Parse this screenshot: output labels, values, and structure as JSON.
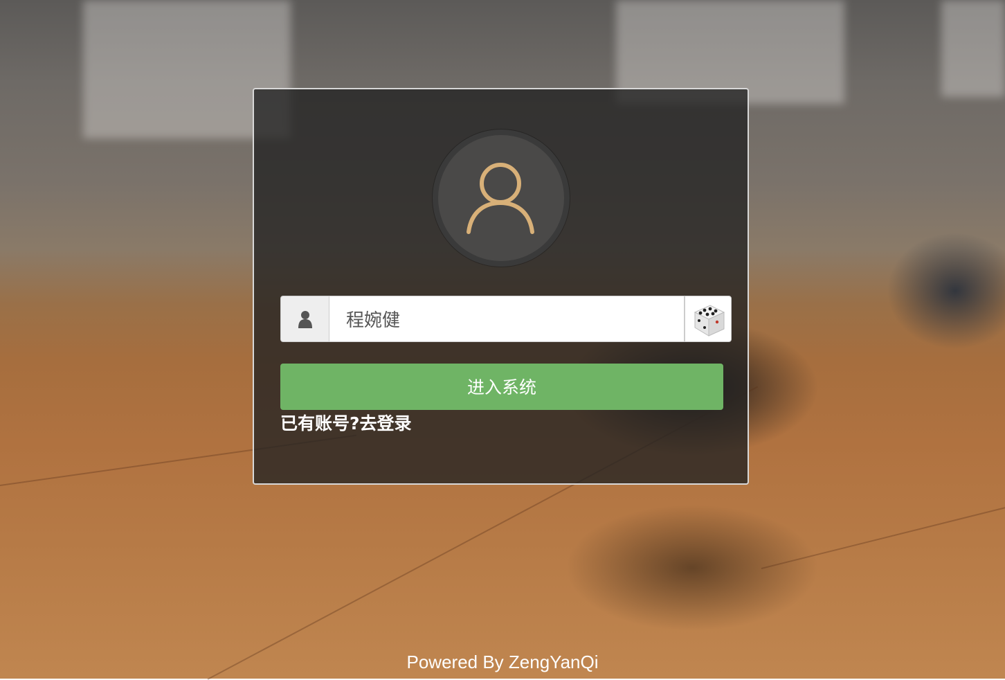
{
  "form": {
    "username_value": "程婉健",
    "submit_label": "进入系统",
    "login_link_label": "已有账号?去登录"
  },
  "footer": {
    "text": "Powered By ZengYanQi"
  },
  "icons": {
    "avatar": "user-outline-icon",
    "input_addon": "user-icon",
    "random_name": "dice-icon"
  },
  "colors": {
    "submit_button": "#6fb465",
    "avatar_stroke": "#d8b078",
    "card_background": "rgba(34,34,34,0.78)"
  }
}
